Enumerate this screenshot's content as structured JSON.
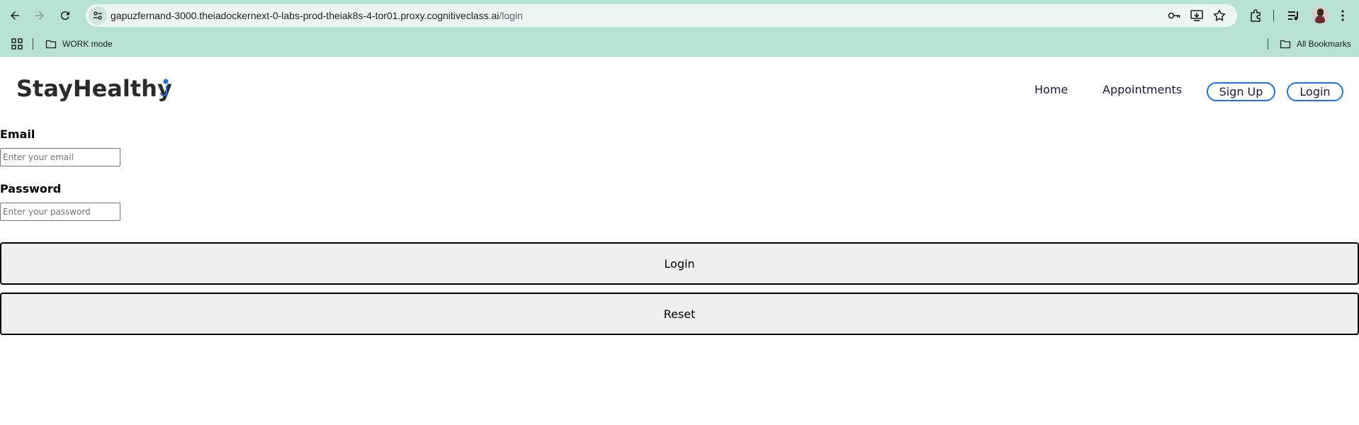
{
  "browser": {
    "url_host": "gapuzfernand-3000.theiadockernext-0-labs-prod-theiak8s-4-tor01.proxy.cognitiveclass.ai",
    "url_path": "/login",
    "bookmarks": {
      "work_mode": "WORK mode",
      "all_bookmarks": "All Bookmarks"
    }
  },
  "navbar": {
    "logo": "StayHealthy",
    "links": {
      "home": "Home",
      "appointments": "Appointments"
    },
    "buttons": {
      "signup": "Sign Up",
      "login": "Login"
    }
  },
  "form": {
    "email": {
      "label": "Email",
      "placeholder": "Enter your email",
      "value": ""
    },
    "password": {
      "label": "Password",
      "placeholder": "Enter your password",
      "value": ""
    },
    "login_button": "Login",
    "reset_button": "Reset"
  },
  "colors": {
    "chrome_bg": "#b7e2d4",
    "accent_blue": "#1a73e8",
    "button_bg": "#efefef"
  }
}
